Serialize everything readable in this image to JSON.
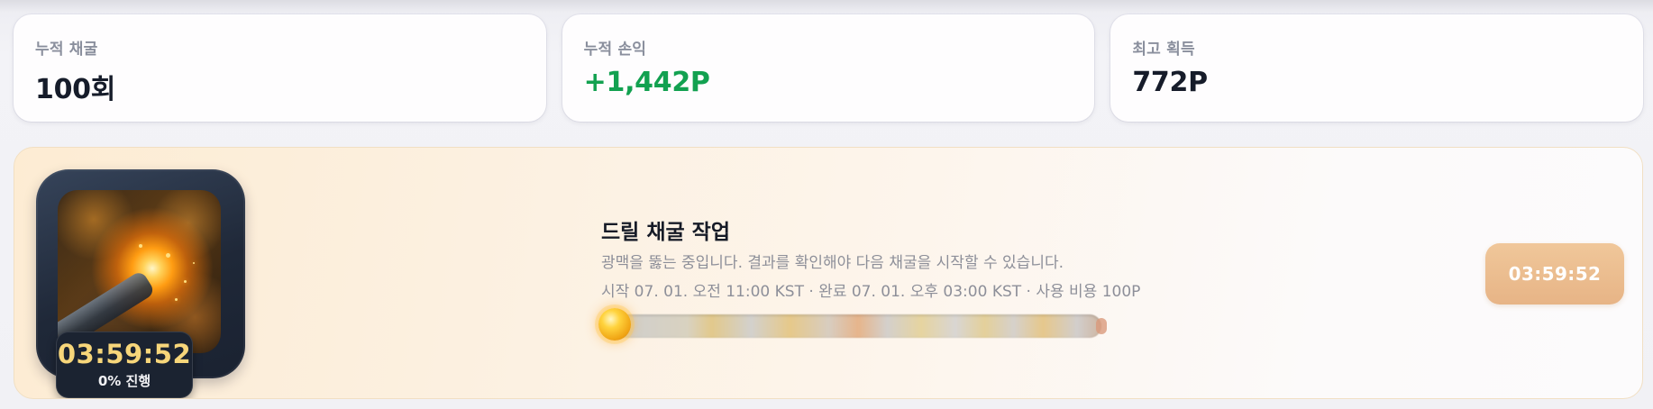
{
  "stats": [
    {
      "label": "누적 채굴",
      "value": "100회"
    },
    {
      "label": "누적 손익",
      "value": "+1,442P"
    },
    {
      "label": "최고 획득",
      "value": "772P"
    }
  ],
  "job": {
    "title": "드릴 채굴 작업",
    "description": "광맥을 뚫는 중입니다. 결과를 확인해야 다음 채굴을 시작할 수 있습니다.",
    "meta": "시작 07. 01. 오전 11:00 KST · 완료 07. 01. 오후 03:00 KST · 사용 비용 100P",
    "thumbnail": {
      "timer": "03:59:52",
      "progress_text": "0% 진행"
    },
    "progress_fraction": 0,
    "remaining_button_label": "03:59:52"
  },
  "colors": {
    "positive": "#12a150",
    "accent_button": "#e7b486",
    "timer_text": "#f7d67a"
  }
}
